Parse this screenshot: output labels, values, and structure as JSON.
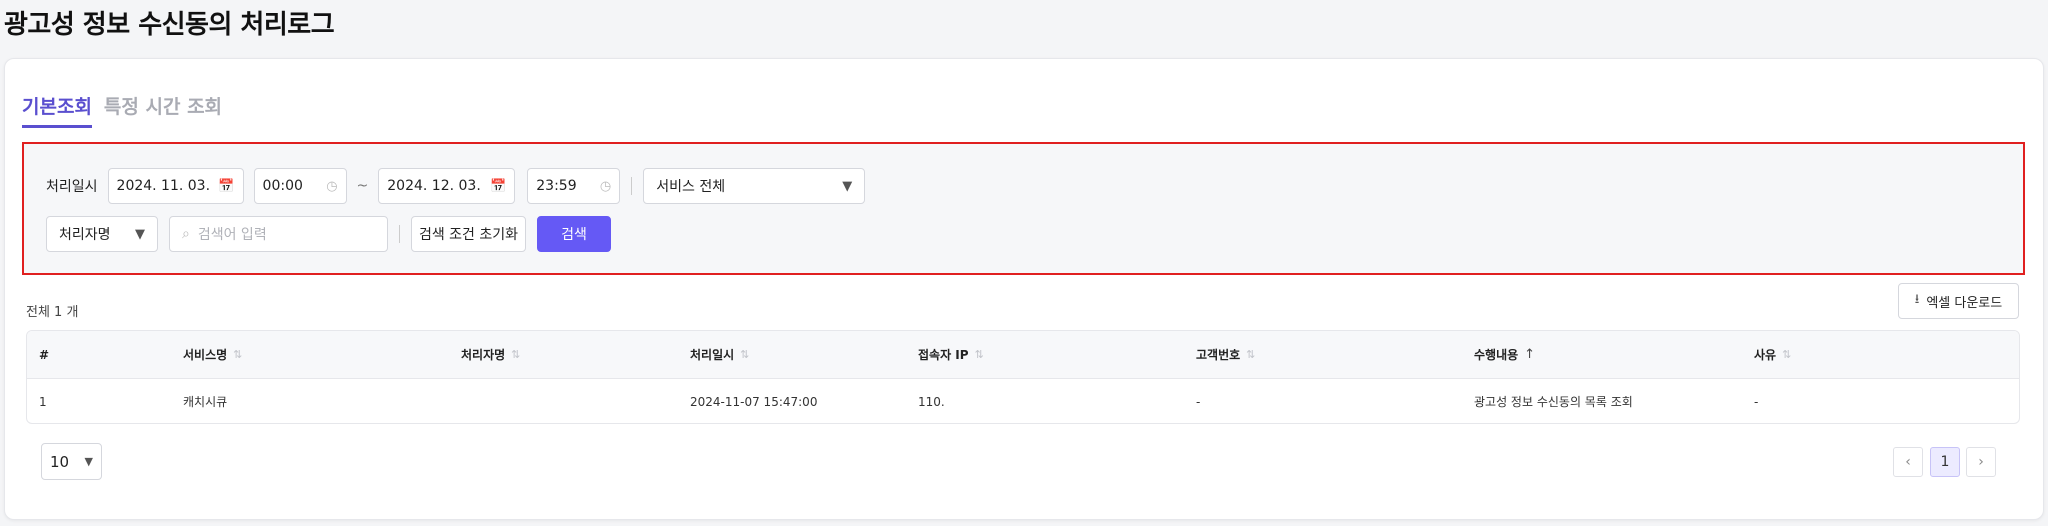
{
  "page": {
    "title": "광고성 정보 수신동의 처리로그"
  },
  "tabs": [
    {
      "label": "기본조회",
      "active": true
    },
    {
      "label": "특정 시간 조회",
      "active": false
    }
  ],
  "filters": {
    "date_label": "처리일시",
    "start_date": "2024. 11. 03.",
    "start_time": "00:00",
    "range_sep": "~",
    "end_date": "2024. 12. 03.",
    "end_time": "23:59",
    "service_select": "서비스 전체",
    "field_select": "처리자명",
    "search_placeholder": "검색어 입력",
    "reset_label": "검색 조건 초기화",
    "search_label": "검색"
  },
  "results": {
    "total_text": "전체 1 개",
    "excel_label": "엑셀 다운로드"
  },
  "table": {
    "columns": [
      "#",
      "서비스명",
      "처리자명",
      "처리일시",
      "접속자 IP",
      "고객번호",
      "수행내용",
      "사유"
    ],
    "rows": [
      [
        "1",
        "캐치시큐",
        "",
        "2024-11-07 15:47:00",
        "110.",
        "-",
        "광고성 정보 수신동의 목록 조회",
        "-"
      ]
    ]
  },
  "pagination": {
    "page_size": "10",
    "current_page": "1"
  },
  "colors": {
    "accent": "#6559f5",
    "highlight_border": "#e02020"
  }
}
